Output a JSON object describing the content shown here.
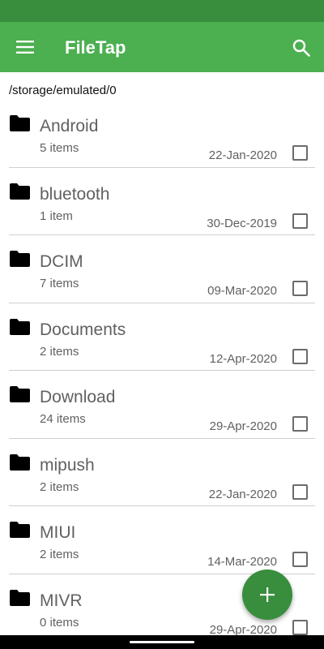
{
  "colors": {
    "status_bar": "#388E3C",
    "app_bar": "#4CAF50",
    "fab": "#388E3C",
    "text_secondary": "#616161"
  },
  "app_bar": {
    "title": "FileTap",
    "menu_icon": "hamburger-menu-icon",
    "search_icon": "search-icon"
  },
  "path": "/storage/emulated/0",
  "files": [
    {
      "name": "Android",
      "count": "5 items",
      "date": "22-Jan-2020"
    },
    {
      "name": "bluetooth",
      "count": "1 item",
      "date": "30-Dec-2019"
    },
    {
      "name": "DCIM",
      "count": "7 items",
      "date": "09-Mar-2020"
    },
    {
      "name": "Documents",
      "count": "2 items",
      "date": "12-Apr-2020"
    },
    {
      "name": "Download",
      "count": "24 items",
      "date": "29-Apr-2020"
    },
    {
      "name": "mipush",
      "count": "2 items",
      "date": "22-Jan-2020"
    },
    {
      "name": "MIUI",
      "count": "2 items",
      "date": "14-Mar-2020"
    },
    {
      "name": "MIVR",
      "count": "0 items",
      "date": "29-Apr-2020"
    }
  ],
  "fab": {
    "icon": "plus-icon"
  }
}
